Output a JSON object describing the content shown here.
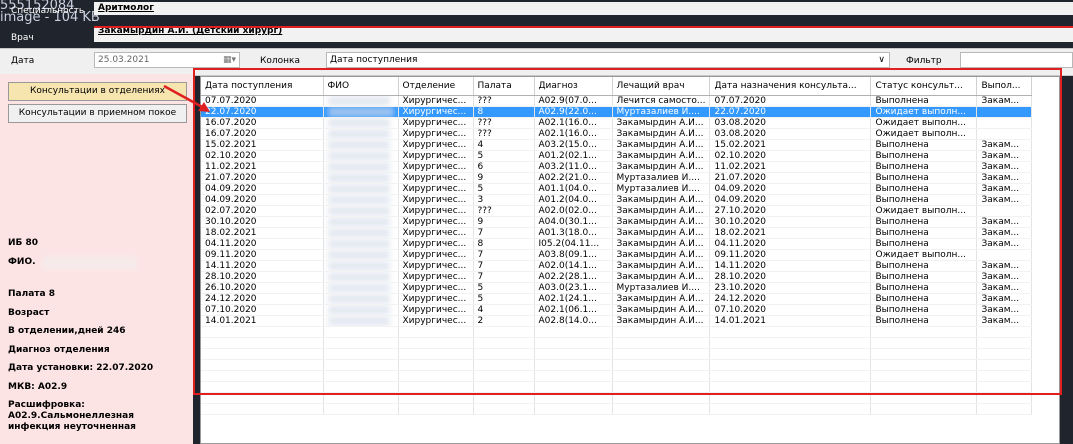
{
  "watermark": {
    "line1": "555152084",
    "line2": "image - 104 KB"
  },
  "header": {
    "specialty_label": "Специальность",
    "specialty_value": "Аритмолог",
    "doctor_label": "Врач",
    "doctor_value": "Закамырдин А.И. (Детский хирург)",
    "date_label": "Дата",
    "date_value": "25.03.2021",
    "column_label": "Колонка",
    "column_value": "Дата поступления",
    "filter_label": "Фильтр",
    "filter_value": ""
  },
  "sidebar": {
    "btn_departments": "Консультации в отделениях",
    "btn_reception": "Консультации в приемном покое",
    "ib": "ИБ 80",
    "fio": "ФИО.",
    "ward": "Палата 8",
    "age": "Возраст",
    "days": "В отделении,дней 246",
    "dept_diag": "Диагноз отделения",
    "diag_date": "Дата установки: 22.07.2020",
    "mkb": "МКВ: A02.9",
    "decode_label": "Расшифровка:",
    "decode_line1": "A02.9.Сальмонеллезная",
    "decode_line2": "инфекция неуточненная"
  },
  "table": {
    "columns": [
      "Дата поступления",
      "ФИО",
      "Отделение",
      "Палата",
      "Диагноз",
      "Лечащий врач",
      "Дата назначения консульта...",
      "Статус консульт...",
      "Выпол..."
    ],
    "rows": [
      [
        "07.07.2020",
        "",
        "Хирургичес...",
        "???",
        "A02.9(07.0...",
        "Лечится самосто...",
        "07.07.2020",
        "Выполнена",
        "Закам..."
      ],
      [
        "22.07.2020",
        "",
        "Хирургичес...",
        "8",
        "A02.9(22.0...",
        "Муртазалиев И....",
        "22.07.2020",
        "Ожидает выполн...",
        ""
      ],
      [
        "16.07.2020",
        "",
        "Хирургичес...",
        "???",
        "A02.1(16.0...",
        "Закамырдин А.И...",
        "03.08.2020",
        "Ожидает выполн...",
        ""
      ],
      [
        "16.07.2020",
        "",
        "Хирургичес...",
        "???",
        "A02.1(16.0...",
        "Закамырдин А.И...",
        "03.08.2020",
        "Ожидает выполн...",
        ""
      ],
      [
        "15.02.2021",
        "",
        "Хирургичес...",
        "4",
        "A03.2(15.0...",
        "Закамырдин А.И...",
        "15.02.2021",
        "Выполнена",
        "Закам..."
      ],
      [
        "02.10.2020",
        "",
        "Хирургичес...",
        "5",
        "A01.2(02.1...",
        "Закамырдин А.И...",
        "02.10.2020",
        "Выполнена",
        "Закам..."
      ],
      [
        "11.02.2021",
        "",
        "Хирургичес...",
        "6",
        "A03.2(11.0...",
        "Закамырдин А.И...",
        "11.02.2021",
        "Выполнена",
        "Закам..."
      ],
      [
        "21.07.2020",
        "",
        "Хирургичес...",
        "9",
        "A02.2(21.0...",
        "Муртазалиев И....",
        "21.07.2020",
        "Выполнена",
        "Закам..."
      ],
      [
        "04.09.2020",
        "",
        "Хирургичес...",
        "5",
        "A01.1(04.0...",
        "Муртазалиев И....",
        "04.09.2020",
        "Выполнена",
        "Закам..."
      ],
      [
        "04.09.2020",
        "",
        "Хирургичес...",
        "3",
        "A01.2(04.0...",
        "Закамырдин А.И...",
        "04.09.2020",
        "Выполнена",
        "Закам..."
      ],
      [
        "02.07.2020",
        "",
        "Хирургичес...",
        "???",
        "A02.0(02.0...",
        "Закамырдин А.И...",
        "27.10.2020",
        "Ожидает выполн...",
        ""
      ],
      [
        "30.10.2020",
        "",
        "Хирургичес...",
        "9",
        "A04.0(30.1...",
        "Закамырдин А.И...",
        "30.10.2020",
        "Выполнена",
        "Закам..."
      ],
      [
        "18.02.2021",
        "",
        "Хирургичес...",
        "7",
        "A01.3(18.0...",
        "Закамырдин А.И...",
        "18.02.2021",
        "Выполнена",
        "Закам..."
      ],
      [
        "04.11.2020",
        "",
        "Хирургичес...",
        "8",
        "I05.2(04.11...",
        "Закамырдин А.И...",
        "04.11.2020",
        "Выполнена",
        "Закам..."
      ],
      [
        "09.11.2020",
        "",
        "Хирургичес...",
        "7",
        "A03.8(09.1...",
        "Закамырдин А.И...",
        "09.11.2020",
        "Ожидает выполн...",
        ""
      ],
      [
        "14.11.2020",
        "",
        "Хирургичес...",
        "7",
        "A02.0(14.1...",
        "Закамырдин А.И...",
        "14.11.2020",
        "Выполнена",
        "Закам..."
      ],
      [
        "28.10.2020",
        "",
        "Хирургичес...",
        "7",
        "A02.2(28.1...",
        "Закамырдин А.И...",
        "28.10.2020",
        "Выполнена",
        "Закам..."
      ],
      [
        "26.10.2020",
        "",
        "Хирургичес...",
        "5",
        "A03.0(23.1...",
        "Муртазалиев И....",
        "23.10.2020",
        "Выполнена",
        "Закам..."
      ],
      [
        "24.12.2020",
        "",
        "Хирургичес...",
        "5",
        "A02.1(24.1...",
        "Закамырдин А.И...",
        "24.12.2020",
        "Выполнена",
        "Закам..."
      ],
      [
        "07.10.2020",
        "",
        "Хирургичес...",
        "4",
        "A02.1(06.1...",
        "Закамырдин А.И...",
        "07.10.2020",
        "Выполнена",
        "Закам..."
      ],
      [
        "14.01.2021",
        "",
        "Хирургичес...",
        "2",
        "A02.8(14.0...",
        "Закамырдин А.И...",
        "14.01.2021",
        "Выполнена",
        "Закам..."
      ]
    ],
    "selected_row": 1
  },
  "colors": {
    "highlight": "#e02020",
    "selection": "#3399ff",
    "sidebar_bg": "#fde4e4"
  }
}
